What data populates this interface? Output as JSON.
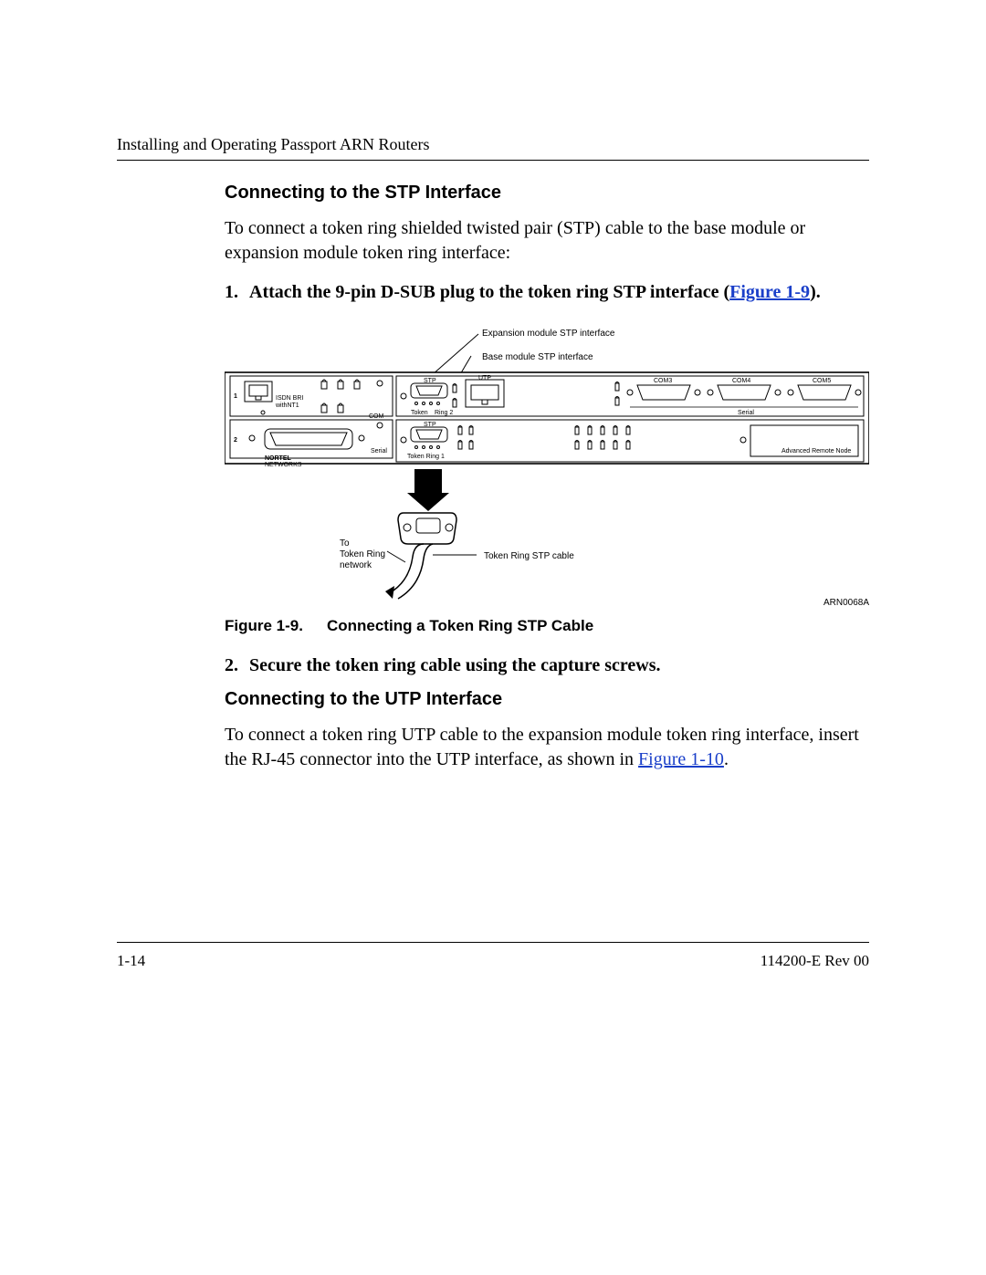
{
  "header": {
    "running": "Installing and Operating Passport ARN Routers"
  },
  "section1": {
    "title": "Connecting to the STP Interface",
    "intro": "To connect a token ring shielded twisted pair (STP) cable to the base module or expansion module token ring interface:",
    "step1_num": "1.",
    "step1_pre": "Attach the 9-pin D-SUB plug to the token ring STP interface (",
    "step1_link": "Figure 1-9",
    "step1_post": ")."
  },
  "figure": {
    "expansion_label": "Expansion module STP  interface",
    "base_label": "Base module STP interface",
    "to_tr_line1": "To",
    "to_tr_line2": "Token Ring",
    "to_tr_line3": "network",
    "cable_label": "Token Ring STP cable",
    "art_id": "ARN0068A",
    "caption_num": "Figure 1-9.",
    "caption_text": "Connecting a Token Ring STP Cable",
    "panel": {
      "slot1": "1",
      "slot2": "2",
      "isdn": "ISDN BRI",
      "withnt1": "withNT1",
      "com": "COM",
      "serial_small": "Serial",
      "nortel1": "NORTEL",
      "nortel2": "NETWORKS",
      "stp": "STP",
      "utp": "UTP",
      "tr1": "Token Ring 1",
      "tr2_a": "Token",
      "tr2_b": "Ring 2",
      "com3": "COM3",
      "com4": "COM4",
      "com5": "COM5",
      "serial": "Serial",
      "arn": "Advanced Remote Node"
    }
  },
  "section1b": {
    "step2_num": "2.",
    "step2_text": "Secure the token ring cable using the capture screws."
  },
  "section2": {
    "title": "Connecting to the UTP Interface",
    "para_pre": "To connect a token ring UTP cable to the expansion module token ring interface, insert the RJ-45 connector into the UTP interface, as shown in ",
    "para_link": "Figure 1-10",
    "para_post": "."
  },
  "footer": {
    "page": "1-14",
    "docid": "114200-E Rev 00"
  }
}
